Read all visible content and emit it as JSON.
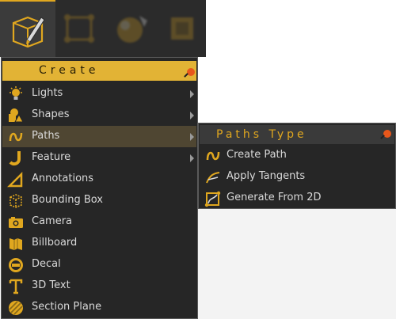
{
  "toolbar": {
    "tools": [
      {
        "icon": "create-tool-icon",
        "active": true
      },
      {
        "icon": "bounding-frame-icon",
        "active": false
      },
      {
        "icon": "shader-ball-icon",
        "active": false
      },
      {
        "icon": "texture-icon",
        "active": false
      }
    ]
  },
  "menu": {
    "title": "Create",
    "items": [
      {
        "label": "Lights",
        "icon": "light-bulb-icon",
        "submenu": true
      },
      {
        "label": "Shapes",
        "icon": "shapes-icon",
        "submenu": true
      },
      {
        "label": "Paths",
        "icon": "path-icon",
        "submenu": true,
        "highlighted": true
      },
      {
        "label": "Feature",
        "icon": "feature-icon",
        "submenu": true
      },
      {
        "label": "Annotations",
        "icon": "annotation-icon",
        "submenu": false
      },
      {
        "label": "Bounding Box",
        "icon": "bounding-box-icon",
        "submenu": false
      },
      {
        "label": "Camera",
        "icon": "camera-icon",
        "submenu": false
      },
      {
        "label": "Billboard",
        "icon": "billboard-icon",
        "submenu": false
      },
      {
        "label": "Decal",
        "icon": "decal-icon",
        "submenu": false
      },
      {
        "label": "3D Text",
        "icon": "text-3d-icon",
        "submenu": false
      },
      {
        "label": "Section Plane",
        "icon": "section-plane-icon",
        "submenu": false
      }
    ]
  },
  "submenu": {
    "title": "Paths Type",
    "items": [
      {
        "label": "Create Path",
        "icon": "create-path-icon"
      },
      {
        "label": "Apply Tangents",
        "icon": "apply-tangents-icon"
      },
      {
        "label": "Generate From 2D",
        "icon": "generate-from-2d-icon"
      }
    ]
  },
  "colors": {
    "accent": "#e2b335",
    "menu_bg": "#262626",
    "hover": "#4f4632",
    "pin": "#e8571b"
  }
}
